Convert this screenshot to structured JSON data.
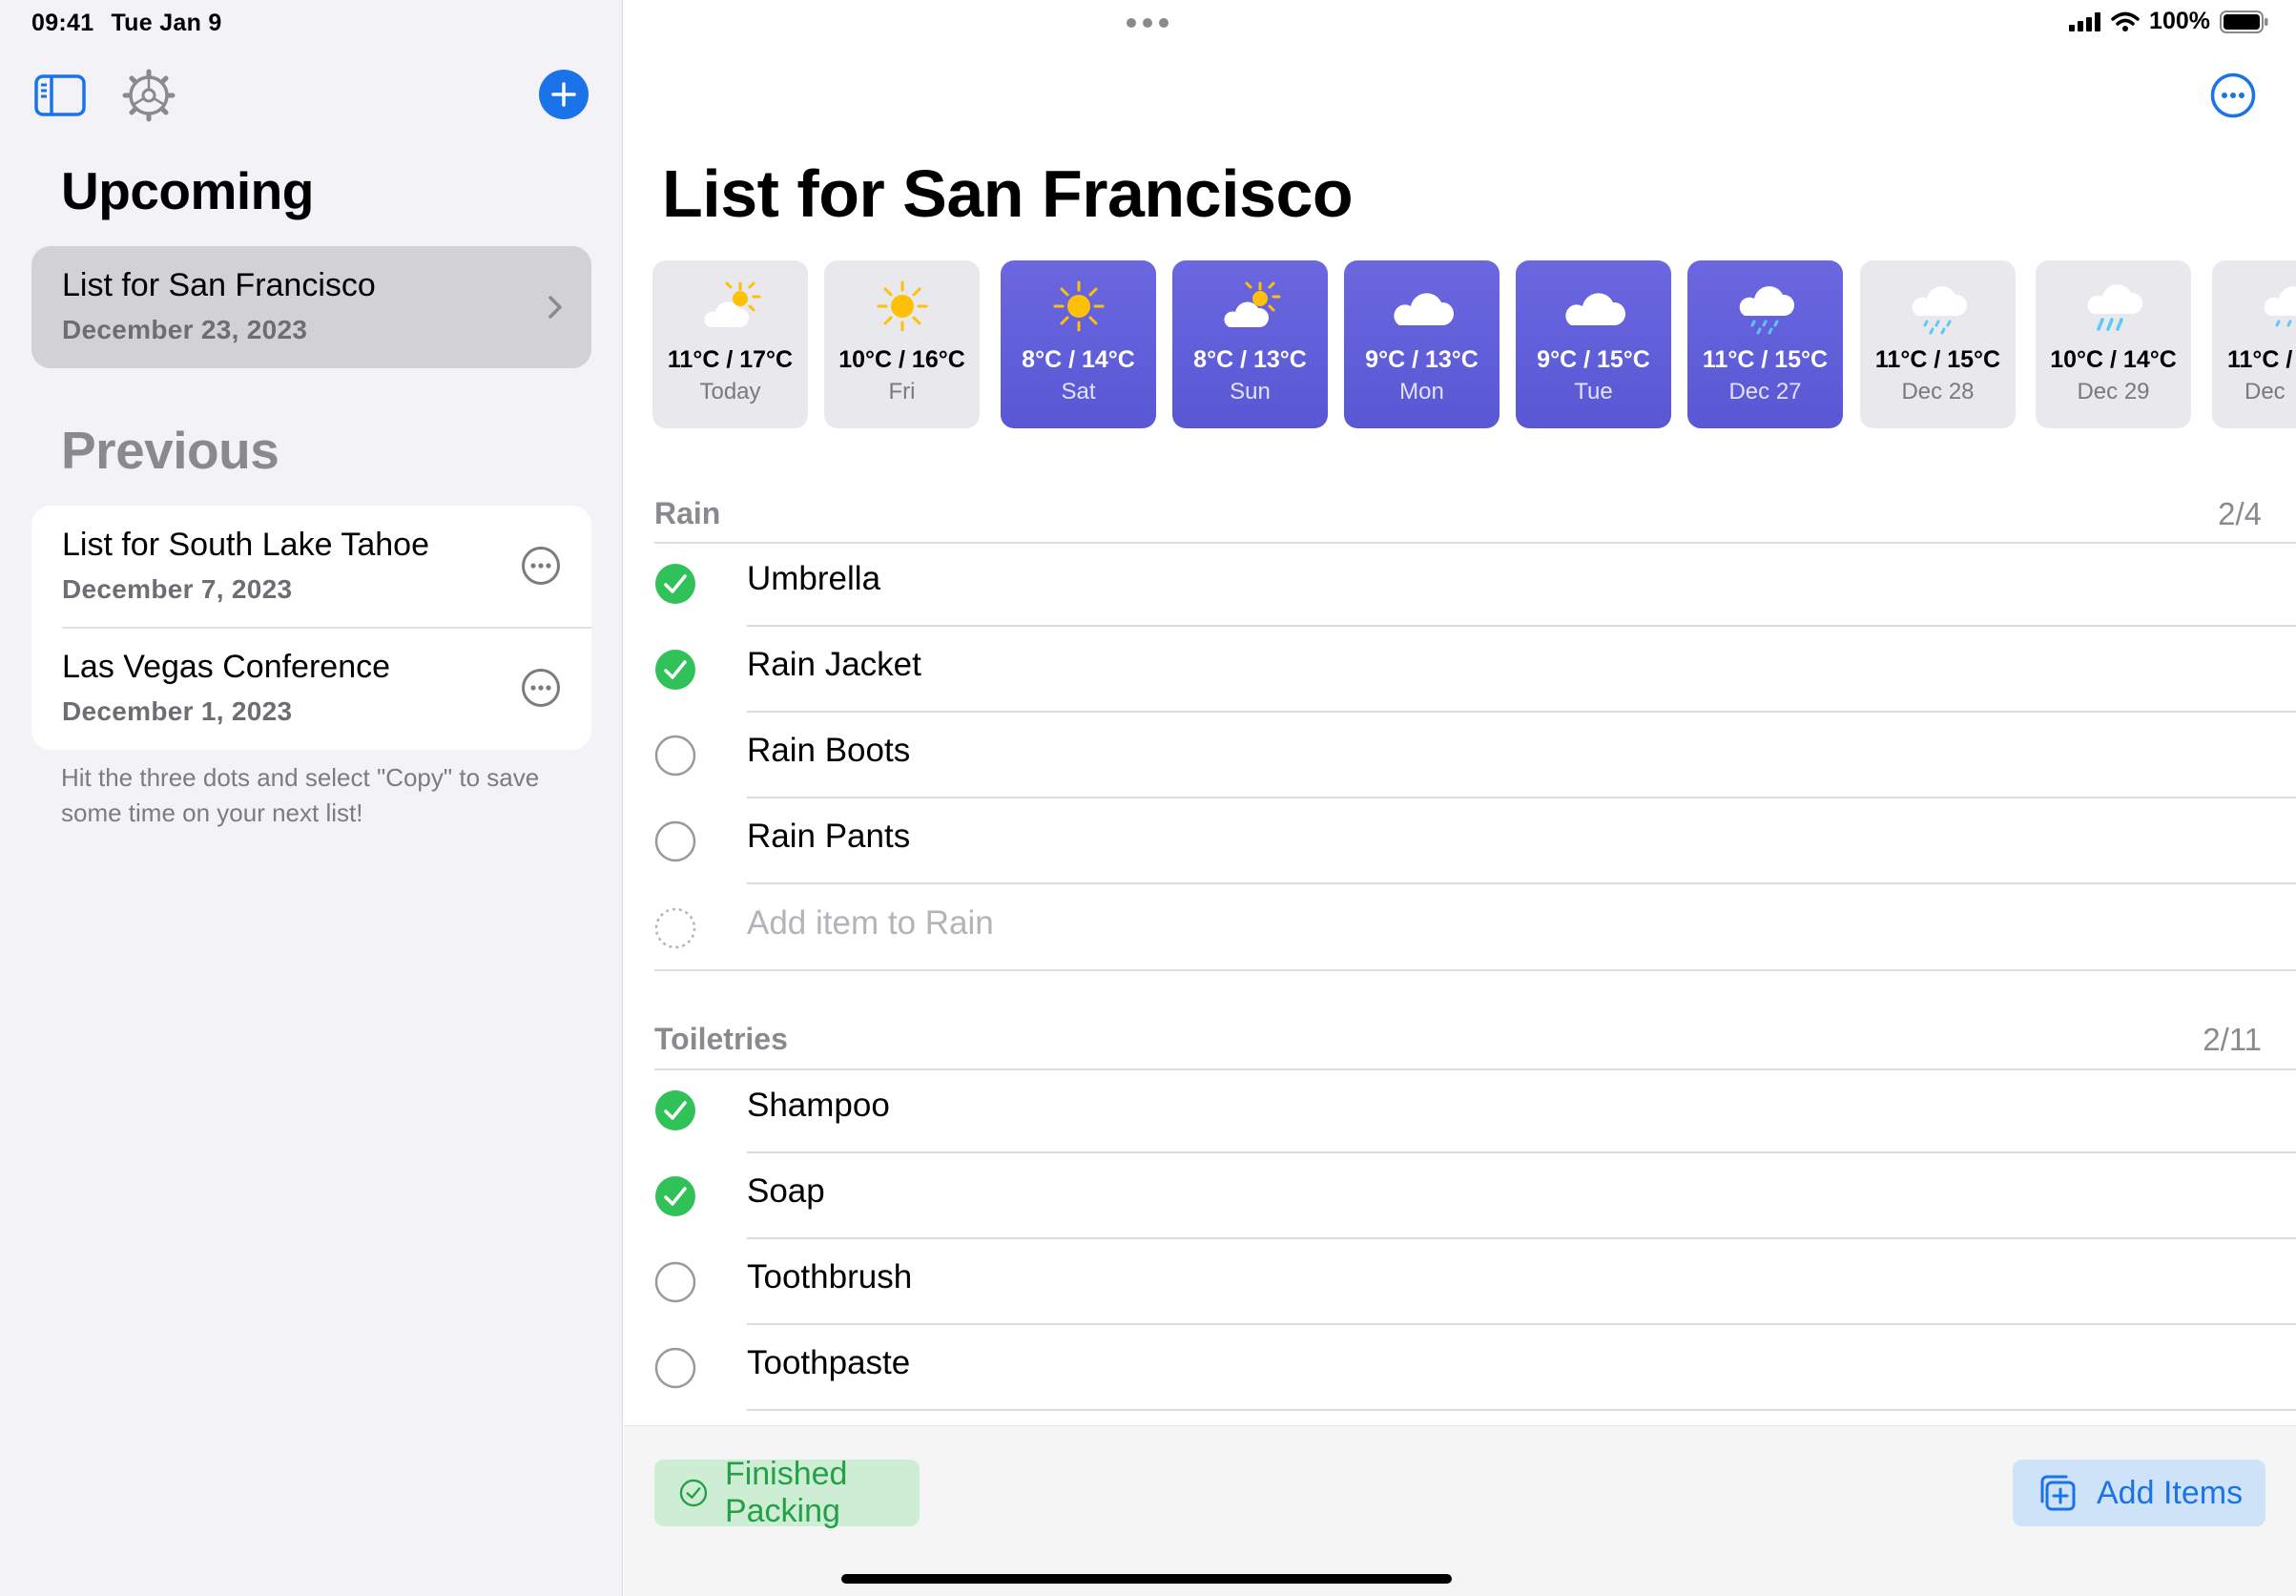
{
  "status_bar": {
    "time": "09:41",
    "date": "Tue Jan 9",
    "battery": "100%"
  },
  "sidebar": {
    "upcoming_title": "Upcoming",
    "upcoming": [
      {
        "title": "List for San Francisco",
        "date": "December 23, 2023"
      }
    ],
    "previous_title": "Previous",
    "previous": [
      {
        "title": "List for South Lake Tahoe",
        "date": "December 7, 2023"
      },
      {
        "title": "Las Vegas Conference",
        "date": "December 1, 2023"
      }
    ],
    "hint": "Hit the three dots and select \"Copy\" to save some time on your next list!",
    "icons": [
      "sidebar-toggle-icon",
      "gear-icon",
      "plus-icon"
    ]
  },
  "main": {
    "title": "List for San Francisco",
    "forecast": [
      {
        "temp": "11°C / 17°C",
        "label": "Today",
        "icon": "partly-sunny-icon",
        "highlight": false
      },
      {
        "temp": "10°C / 16°C",
        "label": "Fri",
        "icon": "sun-icon",
        "highlight": false
      },
      {
        "temp": "8°C / 14°C",
        "label": "Sat",
        "icon": "sun-icon",
        "highlight": true
      },
      {
        "temp": "8°C / 13°C",
        "label": "Sun",
        "icon": "partly-sunny-icon",
        "highlight": true
      },
      {
        "temp": "9°C / 13°C",
        "label": "Mon",
        "icon": "cloud-icon",
        "highlight": true
      },
      {
        "temp": "9°C / 15°C",
        "label": "Tue",
        "icon": "cloud-icon",
        "highlight": true
      },
      {
        "temp": "11°C / 15°C",
        "label": "Dec 27",
        "icon": "cloud-drizzle-icon",
        "highlight": true
      },
      {
        "temp": "11°C / 15°C",
        "label": "Dec 28",
        "icon": "cloud-drizzle-icon",
        "highlight": false
      },
      {
        "temp": "10°C / 14°C",
        "label": "Dec 29",
        "icon": "cloud-rain-icon",
        "highlight": false
      },
      {
        "temp": "11°C /",
        "label": "Dec",
        "icon": "cloud-drizzle-icon",
        "highlight": false
      }
    ],
    "sections": [
      {
        "name": "Rain",
        "count": "2/4",
        "items": [
          {
            "label": "Umbrella",
            "checked": true
          },
          {
            "label": "Rain Jacket",
            "checked": true
          },
          {
            "label": "Rain Boots",
            "checked": false
          },
          {
            "label": "Rain Pants",
            "checked": false
          }
        ],
        "add_placeholder": "Add item to Rain"
      },
      {
        "name": "Toiletries",
        "count": "2/11",
        "items": [
          {
            "label": "Shampoo",
            "checked": true
          },
          {
            "label": "Soap",
            "checked": true
          },
          {
            "label": "Toothbrush",
            "checked": false
          },
          {
            "label": "Toothpaste",
            "checked": false
          }
        ]
      }
    ],
    "finished_button": "Finished Packing",
    "add_items_button": "Add Items"
  },
  "colors": {
    "accent": "#1a73e8",
    "forecast_highlight": "#5a57d4",
    "check_green": "#30c158",
    "sidebar_bg": "#f2f2f7"
  }
}
